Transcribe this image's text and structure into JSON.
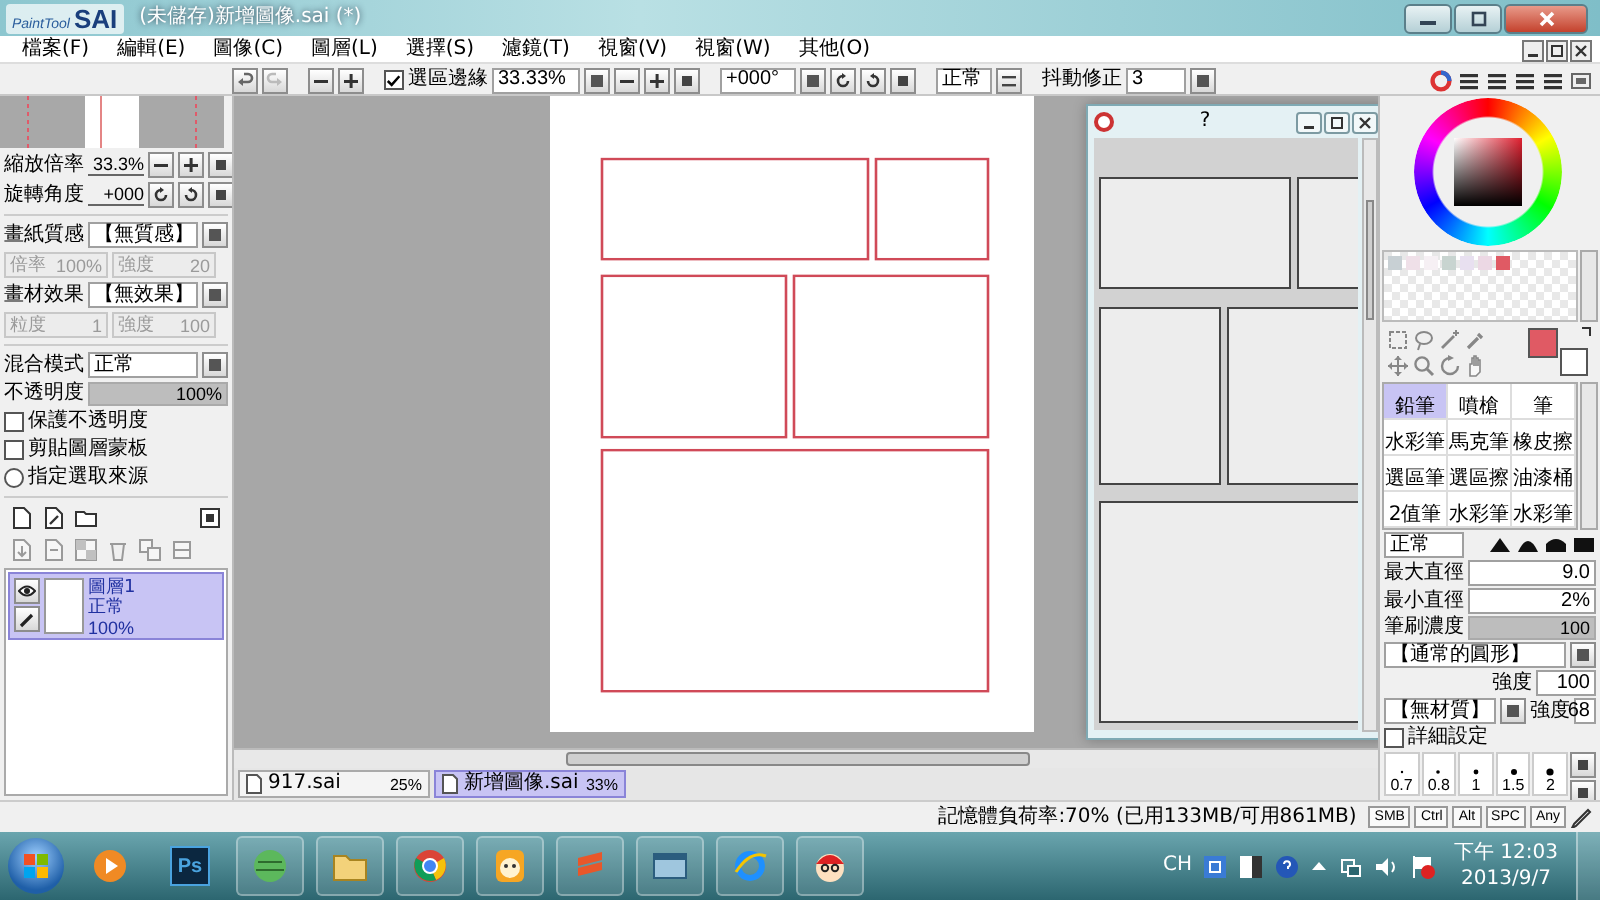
{
  "window": {
    "logo_small": "PaintTool",
    "logo_large": "SAI",
    "title": "(未儲存)新增圖像.sai (*)"
  },
  "menu": [
    "檔案(F)",
    "編輯(E)",
    "圖像(C)",
    "圖層(L)",
    "選擇(S)",
    "濾鏡(T)",
    "視窗(V)",
    "視窗(W)",
    "其他(O)"
  ],
  "toolbar": {
    "selection_edge": {
      "label": "選區邊緣",
      "checked": true
    },
    "zoom": "33.33%",
    "rotation": "+000°",
    "blend_mode": "正常",
    "stabilizer_label": "抖動修正",
    "stabilizer": "3"
  },
  "navigator": {
    "zoom_label": "縮放倍率",
    "zoom": "33.3%",
    "rotation_label": "旋轉角度",
    "rotation": "+000"
  },
  "paper": {
    "texture_label": "畫紙質感",
    "texture": "【無質感】",
    "texture_params": [
      {
        "label": "倍率",
        "value": "100%"
      },
      {
        "label": "強度",
        "value": "20"
      }
    ],
    "effect_label": "畫材效果",
    "effect": "【無效果】",
    "effect_params": [
      {
        "label": "粒度",
        "value": "1"
      },
      {
        "label": "強度",
        "value": "100"
      }
    ],
    "params_disabled": true
  },
  "layer_settings": {
    "blend_label": "混合模式",
    "blend_mode": "正常",
    "opacity_label": "不透明度",
    "opacity": "100%",
    "level": 1,
    "options": [
      {
        "kind": "checkbox",
        "label": "保護不透明度",
        "checked": false
      },
      {
        "kind": "checkbox",
        "label": "剪貼圖層蒙板",
        "checked": false
      },
      {
        "kind": "radio",
        "label": "指定選取來源",
        "checked": false
      }
    ]
  },
  "layers": [
    {
      "name": "圖層1",
      "mode": "正常",
      "opacity": "100%",
      "visible": true,
      "selected": true
    }
  ],
  "documents": [
    {
      "name": "917.sai",
      "zoom": "25%",
      "selected": false
    },
    {
      "name": "新增圖像.sai",
      "zoom": "33%",
      "selected": true
    }
  ],
  "floating_window": {
    "title": "?"
  },
  "brush_tools": [
    {
      "label": "鉛筆",
      "selected": true
    },
    {
      "label": "噴槍",
      "selected": false
    },
    {
      "label": "筆",
      "selected": false
    },
    {
      "label": "水彩筆",
      "selected": false
    },
    {
      "label": "馬克筆",
      "selected": false
    },
    {
      "label": "橡皮擦",
      "selected": false
    },
    {
      "label": "選區筆",
      "selected": false
    },
    {
      "label": "選區擦",
      "selected": false
    },
    {
      "label": "油漆桶",
      "selected": false
    },
    {
      "label": "2值筆",
      "selected": false
    },
    {
      "label": "水彩筆",
      "selected": false
    },
    {
      "label": "水彩筆",
      "selected": false
    }
  ],
  "brush": {
    "mode": "正常",
    "max_size_label": "最大直徑",
    "max_size": "9.0",
    "min_size_label": "最小直徑",
    "min_size": "2%",
    "density_label": "筆刷濃度",
    "density": "100",
    "level": 1,
    "shape": "【通常的圓形】",
    "shape_strength_label": "強度",
    "shape_strength": "100",
    "texture": "【無材質】",
    "texture_strength_label": "強度",
    "texture_strength": "68",
    "details": {
      "label": "詳細設定",
      "checked": false
    },
    "sizes": [
      "0.7",
      "0.8",
      "1",
      "1.5",
      "2"
    ]
  },
  "status_bar": {
    "memory": "記憶體負荷率:70% (已用133MB/可用861MB)",
    "keys": [
      "SMB",
      "Ctrl",
      "Alt",
      "SPC",
      "Any"
    ]
  },
  "taskbar": {
    "photoshop_label": "Ps",
    "language": "CH",
    "time": "下午 12:03",
    "date": "2013/9/7"
  }
}
